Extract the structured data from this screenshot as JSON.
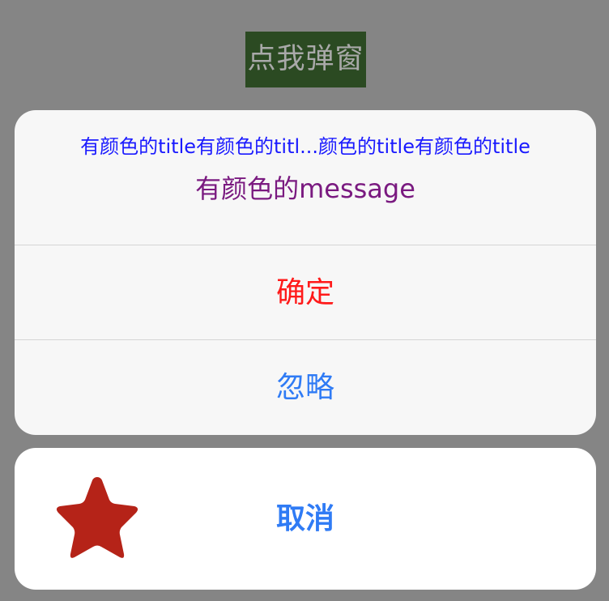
{
  "trigger": {
    "label": "点我弹窗"
  },
  "alert": {
    "title": "有颜色的title有颜色的titl...颜色的title有颜色的title",
    "message": "有颜色的message",
    "actions": [
      {
        "label": "确定",
        "color": "#ff1a1a"
      },
      {
        "label": "忽略",
        "color": "#2f7bf5"
      }
    ]
  },
  "cancel": {
    "label": "取消",
    "icon": "star-icon"
  },
  "colors": {
    "background": "#858585",
    "trigger_bg": "#2b4a22",
    "trigger_text": "#a9a9a9",
    "title": "#1a1aff",
    "message": "#7a1a80",
    "confirm": "#ff1a1a",
    "ignore": "#2f7bf5",
    "cancel": "#2f7bf5",
    "star": "#b52318"
  }
}
